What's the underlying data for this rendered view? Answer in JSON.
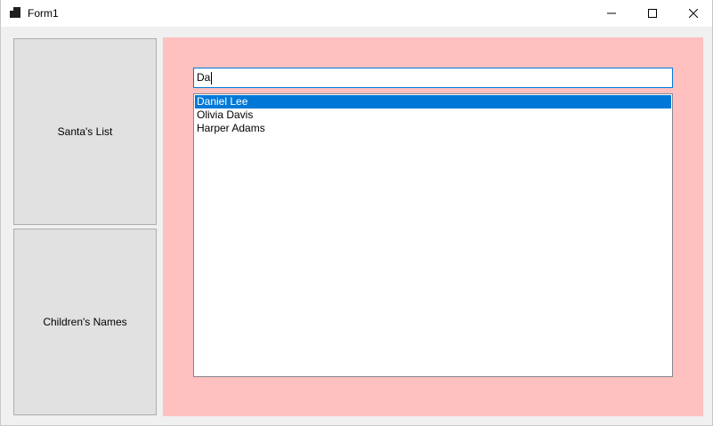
{
  "window": {
    "title": "Form1",
    "icon": "winforms-app-icon",
    "controls": [
      "minimize-icon",
      "maximize-icon",
      "close-icon"
    ]
  },
  "sidebar": {
    "buttons": [
      {
        "label": "Santa's List"
      },
      {
        "label": "Children's Names"
      }
    ]
  },
  "main": {
    "panel_color": "#ffc0c0",
    "search": {
      "value": "Da"
    },
    "list": {
      "items": [
        "Daniel Lee",
        "Olivia Davis",
        "Harper Adams"
      ],
      "selected_index": 0,
      "selection_color": "#0078d7"
    }
  }
}
